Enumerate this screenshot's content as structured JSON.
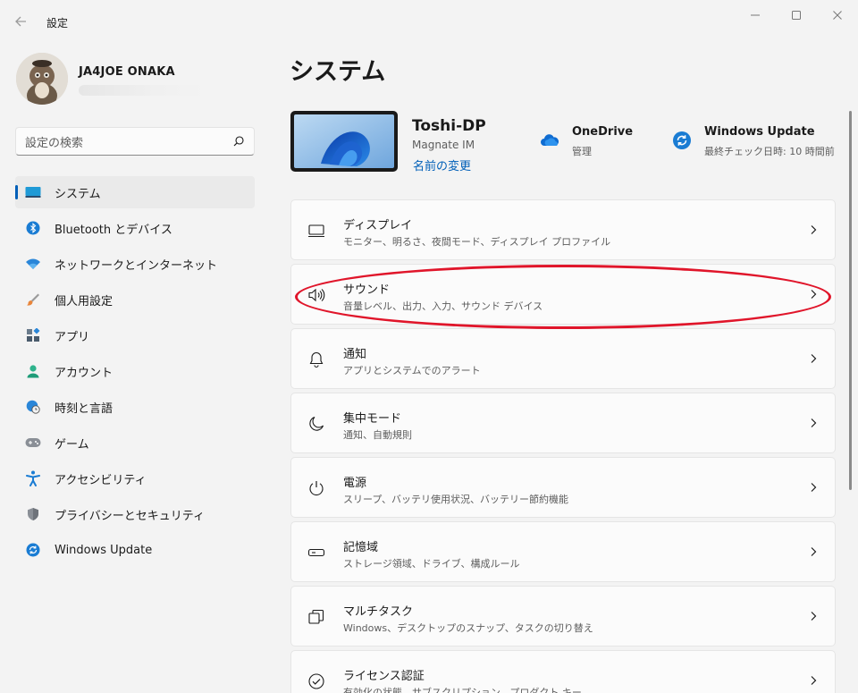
{
  "window": {
    "title": "設定",
    "controls": [
      "minimize",
      "maximize",
      "close"
    ]
  },
  "profile": {
    "name": "JA4JOE ONAKA"
  },
  "search": {
    "placeholder": "設定の検索"
  },
  "sidebar": {
    "items": [
      {
        "label": "システム",
        "icon": "monitor-icon",
        "active": true
      },
      {
        "label": "Bluetooth とデバイス",
        "icon": "bluetooth-icon"
      },
      {
        "label": "ネットワークとインターネット",
        "icon": "wifi-icon"
      },
      {
        "label": "個人用設定",
        "icon": "brush-icon"
      },
      {
        "label": "アプリ",
        "icon": "apps-icon"
      },
      {
        "label": "アカウント",
        "icon": "person-icon"
      },
      {
        "label": "時刻と言語",
        "icon": "globe-clock-icon"
      },
      {
        "label": "ゲーム",
        "icon": "gamepad-icon"
      },
      {
        "label": "アクセシビリティ",
        "icon": "accessibility-icon"
      },
      {
        "label": "プライバシーとセキュリティ",
        "icon": "shield-icon"
      },
      {
        "label": "Windows Update",
        "icon": "sync-icon"
      }
    ]
  },
  "main": {
    "page_title": "システム",
    "device": {
      "name": "Toshi-DP",
      "model": "Magnate IM",
      "rename_link": "名前の変更"
    },
    "onedrive": {
      "title": "OneDrive",
      "subtitle": "管理"
    },
    "windows_update": {
      "title": "Windows Update",
      "subtitle": "最終チェック日時: 10 時間前"
    },
    "cards": [
      {
        "title": "ディスプレイ",
        "subtitle": "モニター、明るさ、夜間モード、ディスプレイ プロファイル",
        "icon": "display-icon"
      },
      {
        "title": "サウンド",
        "subtitle": "音量レベル、出力、入力、サウンド デバイス",
        "icon": "speaker-icon"
      },
      {
        "title": "通知",
        "subtitle": "アプリとシステムでのアラート",
        "icon": "bell-icon"
      },
      {
        "title": "集中モード",
        "subtitle": "通知、自動規則",
        "icon": "moon-icon"
      },
      {
        "title": "電源",
        "subtitle": "スリープ、バッテリ使用状況、バッテリー節約機能",
        "icon": "power-icon"
      },
      {
        "title": "記憶域",
        "subtitle": "ストレージ領域、ドライブ、構成ルール",
        "icon": "storage-icon"
      },
      {
        "title": "マルチタスク",
        "subtitle": "Windows、デスクトップのスナップ、タスクの切り替え",
        "icon": "multitask-icon"
      },
      {
        "title": "ライセンス認証",
        "subtitle": "有効化の状態、サブスクリプション、プロダクト キー",
        "icon": "check-circle-icon"
      }
    ]
  },
  "colors": {
    "accent": "#005fb8",
    "highlight_ring": "#e0152a",
    "background": "#f3f3f3",
    "card": "#fbfbfb"
  }
}
